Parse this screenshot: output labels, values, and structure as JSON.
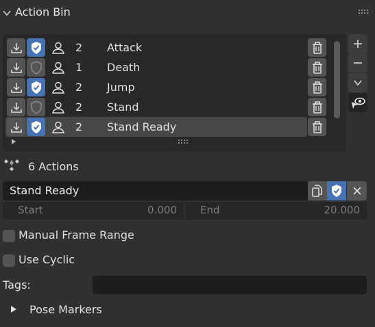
{
  "panel": {
    "title": "Action Bin"
  },
  "list": {
    "rows": [
      {
        "count": "2",
        "name": "Attack",
        "fake_user": true
      },
      {
        "count": "1",
        "name": "Death",
        "fake_user": false
      },
      {
        "count": "2",
        "name": "Jump",
        "fake_user": true
      },
      {
        "count": "2",
        "name": "Stand",
        "fake_user": false
      },
      {
        "count": "2",
        "name": "Stand Ready",
        "fake_user": true,
        "active": true
      }
    ]
  },
  "actions_count": "6 Actions",
  "active_action": {
    "name": "Stand Ready"
  },
  "range": {
    "start_label": "Start",
    "start_value": "0.000",
    "end_label": "End",
    "end_value": "20.000"
  },
  "options": {
    "manual_frame_range": {
      "label": "Manual Frame Range",
      "checked": false
    },
    "use_cyclic": {
      "label": "Use Cyclic",
      "checked": false
    }
  },
  "tags": {
    "label": "Tags:",
    "value": ""
  },
  "pose_markers": {
    "label": "Pose Markers"
  },
  "colors": {
    "accent": "#4772b3",
    "background": "#303030",
    "field": "#1d1d1d"
  }
}
